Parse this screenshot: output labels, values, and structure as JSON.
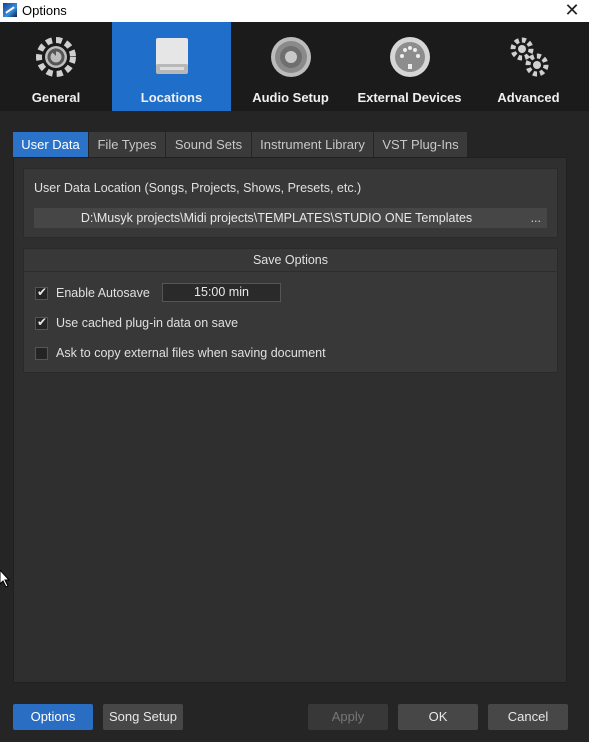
{
  "window": {
    "title": "Options"
  },
  "categories": [
    {
      "label": "General",
      "icon": "gear-refresh-icon",
      "active": false
    },
    {
      "label": "Locations",
      "icon": "drive-icon",
      "active": true
    },
    {
      "label": "Audio Setup",
      "icon": "speaker-icon",
      "active": false
    },
    {
      "label": "External Devices",
      "icon": "midi-din-icon",
      "active": false
    },
    {
      "label": "Advanced",
      "icon": "gears-icon",
      "active": false
    }
  ],
  "tabs": [
    {
      "label": "User Data",
      "active": true
    },
    {
      "label": "File Types",
      "active": false
    },
    {
      "label": "Sound Sets",
      "active": false
    },
    {
      "label": "Instrument Library",
      "active": false
    },
    {
      "label": "VST Plug-Ins",
      "active": false
    }
  ],
  "user_data": {
    "location_label": "User Data Location (Songs, Projects, Shows, Presets, etc.)",
    "path": "D:\\Musyk projects\\Midi projects\\TEMPLATES\\STUDIO ONE Templates",
    "browse_label": "..."
  },
  "save_options": {
    "title": "Save Options",
    "autosave": {
      "label": "Enable Autosave",
      "checked": true,
      "interval": "15:00 min"
    },
    "cached_plugin": {
      "label": "Use cached plug-in data on save",
      "checked": true
    },
    "copy_external": {
      "label": "Ask to copy external files when saving document",
      "checked": false
    }
  },
  "footer": {
    "options": "Options",
    "song_setup": "Song Setup",
    "apply": "Apply",
    "ok": "OK",
    "cancel": "Cancel"
  },
  "colors": {
    "accent": "#1f6ec9",
    "background": "#252525",
    "panel": "#2f2f2f"
  }
}
